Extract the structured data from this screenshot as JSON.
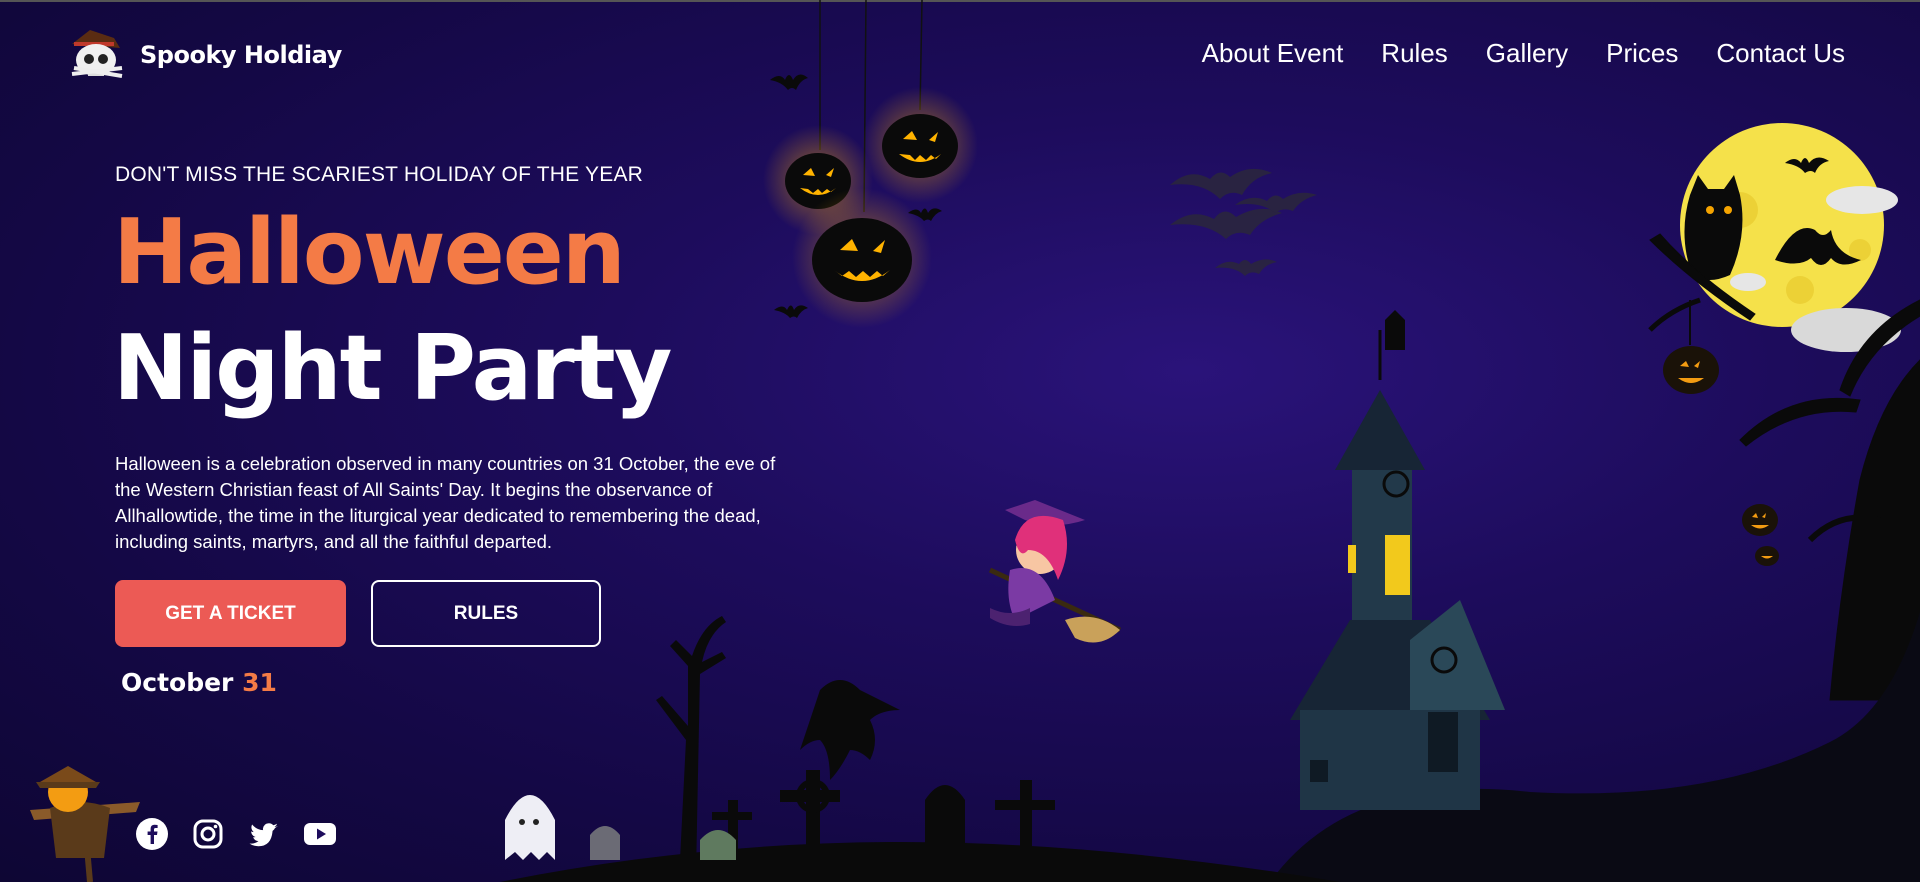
{
  "header": {
    "logo_text": "Spooky Holdiay",
    "nav": [
      {
        "label": "About Event"
      },
      {
        "label": "Rules"
      },
      {
        "label": "Gallery"
      },
      {
        "label": "Prices"
      },
      {
        "label": "Contact Us"
      }
    ]
  },
  "hero": {
    "eyebrow": "DON'T MISS THE SCARIEST HOLIDAY OF THE YEAR",
    "title_line1": "Halloween",
    "title_line2": "Night Party",
    "description": "Halloween is a celebration observed in many countries on 31 October, the eve of the Western Christian feast of All Saints' Day. It begins the observance of Allhallowtide, the time in the liturgical year dedicated to remembering the dead, including saints, martyrs, and all the faithful departed.",
    "ticket_button": "GET A TICKET",
    "rules_button": "RULES",
    "date_month": "October",
    "date_day": "31"
  },
  "socials": [
    {
      "icon": "facebook-icon"
    },
    {
      "icon": "instagram-icon"
    },
    {
      "icon": "twitter-icon"
    },
    {
      "icon": "youtube-icon"
    }
  ],
  "colors": {
    "background": "#1d0c5c",
    "accent_orange": "#f47b46",
    "button_red": "#ec5a55",
    "moon": "#f5e14a"
  }
}
